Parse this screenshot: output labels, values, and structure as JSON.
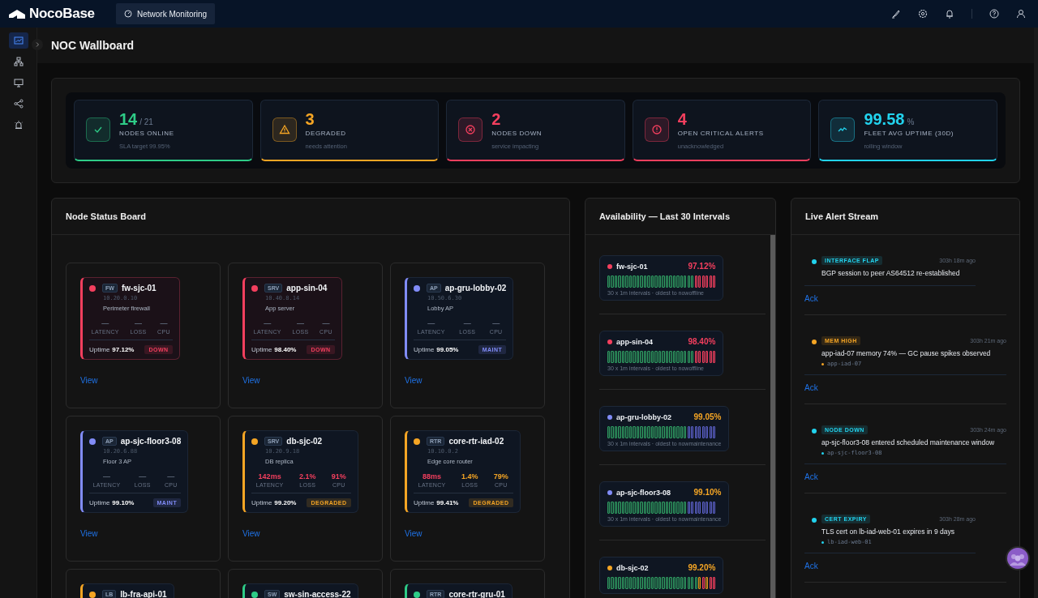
{
  "app": {
    "logo": "NocoBase",
    "tab": "Network Monitoring"
  },
  "sidebar": {
    "items": [
      {
        "selected": true
      },
      {
        "selected": false
      },
      {
        "selected": false
      },
      {
        "selected": false
      },
      {
        "selected": false
      }
    ]
  },
  "page_title": "NOC Wallboard",
  "kpis": [
    {
      "kind": "ok",
      "value": "14",
      "total": "/ 21",
      "label": "NODES ONLINE",
      "note": "SLA target 99.95%",
      "color": "#2ecc87"
    },
    {
      "kind": "warning",
      "value": "3",
      "label": "DEGRADED",
      "note": "needs attention",
      "color": "#f5a524"
    },
    {
      "kind": "down",
      "value": "2",
      "label": "NODES DOWN",
      "note": "service impacting",
      "color": "#f43f5e"
    },
    {
      "kind": "alert",
      "value": "4",
      "label": "OPEN CRITICAL ALERTS",
      "note": "unacknowledged",
      "color": "#f43f5e"
    },
    {
      "kind": "uptime",
      "value": "99.58",
      "unit": "%",
      "label": "FLEET AVG UPTIME (30D)",
      "note": "rolling window",
      "color": "#22d3ee"
    }
  ],
  "node_board": {
    "title": "Node Status Board",
    "nodes": [
      {
        "color": "#f43f5e",
        "critical": true,
        "type": "FW",
        "name": "fw-sjc-01",
        "ip": "10.20.0.10",
        "description": "Perimeter firewall",
        "metrics": [
          {
            "value": "—",
            "label": "LATENCY",
            "color": "#5b6677"
          },
          {
            "value": "—",
            "label": "LOSS",
            "color": "#5b6677"
          },
          {
            "value": "—",
            "label": "CPU",
            "color": "#5b6677"
          }
        ],
        "uptime_label": "Uptime",
        "uptime": "97.12%",
        "badge": "DOWN",
        "action": "View"
      },
      {
        "color": "#f43f5e",
        "critical": true,
        "type": "SRV",
        "name": "app-sin-04",
        "ip": "10.40.8.14",
        "description": "App server",
        "metrics": [
          {
            "value": "—",
            "label": "LATENCY",
            "color": "#5b6677"
          },
          {
            "value": "—",
            "label": "LOSS",
            "color": "#5b6677"
          },
          {
            "value": "—",
            "label": "CPU",
            "color": "#5b6677"
          }
        ],
        "uptime_label": "Uptime",
        "uptime": "98.40%",
        "badge": "DOWN",
        "action": "View"
      },
      {
        "color": "#818cf8",
        "critical": false,
        "type": "AP",
        "name": "ap-gru-lobby-02",
        "ip": "10.50.6.30",
        "description": "Lobby AP",
        "metrics": [
          {
            "value": "—",
            "label": "LATENCY",
            "color": "#5b6677"
          },
          {
            "value": "—",
            "label": "LOSS",
            "color": "#5b6677"
          },
          {
            "value": "—",
            "label": "CPU",
            "color": "#5b6677"
          }
        ],
        "uptime_label": "Uptime",
        "uptime": "99.05%",
        "badge": "MAINT",
        "action": "View"
      },
      {
        "color": "#818cf8",
        "critical": false,
        "type": "AP",
        "name": "ap-sjc-floor3-08",
        "ip": "10.20.6.88",
        "description": "Floor 3 AP",
        "metrics": [
          {
            "value": "—",
            "label": "LATENCY",
            "color": "#5b6677"
          },
          {
            "value": "—",
            "label": "LOSS",
            "color": "#5b6677"
          },
          {
            "value": "—",
            "label": "CPU",
            "color": "#5b6677"
          }
        ],
        "uptime_label": "Uptime",
        "uptime": "99.10%",
        "badge": "MAINT",
        "action": "View"
      },
      {
        "color": "#f5a524",
        "critical": false,
        "type": "SRV",
        "name": "db-sjc-02",
        "ip": "10.20.9.18",
        "description": "DB replica",
        "metrics": [
          {
            "value": "142ms",
            "label": "LATENCY",
            "color": "#f43f5e"
          },
          {
            "value": "2.1%",
            "label": "LOSS",
            "color": "#f43f5e"
          },
          {
            "value": "91%",
            "label": "CPU",
            "color": "#f43f5e"
          }
        ],
        "uptime_label": "Uptime",
        "uptime": "99.20%",
        "badge": "DEGRADED",
        "action": "View"
      },
      {
        "color": "#f5a524",
        "critical": false,
        "type": "RTR",
        "name": "core-rtr-iad-02",
        "ip": "10.10.0.2",
        "description": "Edge core router",
        "metrics": [
          {
            "value": "88ms",
            "label": "LATENCY",
            "color": "#f43f5e"
          },
          {
            "value": "1.4%",
            "label": "LOSS",
            "color": "#f5a524"
          },
          {
            "value": "79%",
            "label": "CPU",
            "color": "#f5a524"
          }
        ],
        "uptime_label": "Uptime",
        "uptime": "99.41%",
        "badge": "DEGRADED",
        "action": "View"
      },
      {
        "color": "#f5a524",
        "critical": false,
        "type": "LB",
        "name": "lb-fra-api-01"
      },
      {
        "color": "#2ecc87",
        "critical": false,
        "type": "SW",
        "name": "sw-sin-access-22"
      },
      {
        "color": "#2ecc87",
        "critical": false,
        "type": "RTR",
        "name": "core-rtr-gru-01"
      }
    ]
  },
  "availability": {
    "title": "Availability — Last 30 Intervals",
    "items": [
      {
        "color": "#f43f5e",
        "critical": true,
        "name": "fw-sjc-01",
        "uptime": "97.12%",
        "legend": "30 x 1m intervals · oldest to nowoffline",
        "bars": [
          {
            "color": "#2f9e62"
          },
          {
            "color": "#2f9e62"
          },
          {
            "color": "#2f9e62"
          },
          {
            "color": "#2f9e62"
          },
          {
            "color": "#2f9e62"
          },
          {
            "color": "#2f9e62"
          },
          {
            "color": "#2f9e62"
          },
          {
            "color": "#2f9e62"
          },
          {
            "color": "#2f9e62"
          },
          {
            "color": "#2f9e62"
          },
          {
            "color": "#2f9e62"
          },
          {
            "color": "#2f9e62"
          },
          {
            "color": "#2f9e62"
          },
          {
            "color": "#2f9e62"
          },
          {
            "color": "#2f9e62"
          },
          {
            "color": "#2f9e62"
          },
          {
            "color": "#2f9e62"
          },
          {
            "color": "#2f9e62"
          },
          {
            "color": "#2f9e62"
          },
          {
            "color": "#2f9e62"
          },
          {
            "color": "#2f9e62"
          },
          {
            "color": "#2f9e62"
          },
          {
            "color": "#2f9e62"
          },
          {
            "color": "#2f9e62"
          },
          {
            "color": "#f43f5e"
          },
          {
            "color": "#f43f5e"
          },
          {
            "color": "#f43f5e"
          },
          {
            "color": "#f43f5e"
          },
          {
            "color": "#f43f5e"
          },
          {
            "color": "#f43f5e"
          }
        ]
      },
      {
        "color": "#f43f5e",
        "critical": true,
        "name": "app-sin-04",
        "uptime": "98.40%",
        "legend": "30 x 1m intervals · oldest to nowoffline",
        "bars": [
          {
            "color": "#2f9e62"
          },
          {
            "color": "#2f9e62"
          },
          {
            "color": "#2f9e62"
          },
          {
            "color": "#2f9e62"
          },
          {
            "color": "#2f9e62"
          },
          {
            "color": "#2f9e62"
          },
          {
            "color": "#2f9e62"
          },
          {
            "color": "#2f9e62"
          },
          {
            "color": "#2f9e62"
          },
          {
            "color": "#2f9e62"
          },
          {
            "color": "#2f9e62"
          },
          {
            "color": "#2f9e62"
          },
          {
            "color": "#2f9e62"
          },
          {
            "color": "#2f9e62"
          },
          {
            "color": "#2f9e62"
          },
          {
            "color": "#2f9e62"
          },
          {
            "color": "#2f9e62"
          },
          {
            "color": "#2f9e62"
          },
          {
            "color": "#2f9e62"
          },
          {
            "color": "#2f9e62"
          },
          {
            "color": "#2f9e62"
          },
          {
            "color": "#2f9e62"
          },
          {
            "color": "#2f9e62"
          },
          {
            "color": "#2f9e62"
          },
          {
            "color": "#f43f5e"
          },
          {
            "color": "#f43f5e"
          },
          {
            "color": "#f43f5e"
          },
          {
            "color": "#f43f5e"
          },
          {
            "color": "#f43f5e"
          },
          {
            "color": "#f43f5e"
          }
        ]
      },
      {
        "color": "#818cf8",
        "critical": false,
        "name": "ap-gru-lobby-02",
        "uptime": "99.05%",
        "legend": "30 x 1m intervals · oldest to nowmaintenance",
        "bars": [
          {
            "color": "#2f9e62"
          },
          {
            "color": "#2f9e62"
          },
          {
            "color": "#2f9e62"
          },
          {
            "color": "#2f9e62"
          },
          {
            "color": "#2f9e62"
          },
          {
            "color": "#2f9e62"
          },
          {
            "color": "#2f9e62"
          },
          {
            "color": "#2f9e62"
          },
          {
            "color": "#2f9e62"
          },
          {
            "color": "#2f9e62"
          },
          {
            "color": "#2f9e62"
          },
          {
            "color": "#2f9e62"
          },
          {
            "color": "#2f9e62"
          },
          {
            "color": "#2f9e62"
          },
          {
            "color": "#2f9e62"
          },
          {
            "color": "#2f9e62"
          },
          {
            "color": "#2f9e62"
          },
          {
            "color": "#2f9e62"
          },
          {
            "color": "#2f9e62"
          },
          {
            "color": "#2f9e62"
          },
          {
            "color": "#2f9e62"
          },
          {
            "color": "#2f9e62"
          },
          {
            "color": "#5b60c8"
          },
          {
            "color": "#5b60c8"
          },
          {
            "color": "#5b60c8"
          },
          {
            "color": "#5b60c8"
          },
          {
            "color": "#5b60c8"
          },
          {
            "color": "#5b60c8"
          },
          {
            "color": "#5b60c8"
          },
          {
            "color": "#5b60c8"
          }
        ]
      },
      {
        "color": "#818cf8",
        "critical": false,
        "name": "ap-sjc-floor3-08",
        "uptime": "99.10%",
        "legend": "30 x 1m intervals · oldest to nowmaintenance",
        "bars": [
          {
            "color": "#2f9e62"
          },
          {
            "color": "#2f9e62"
          },
          {
            "color": "#2f9e62"
          },
          {
            "color": "#2f9e62"
          },
          {
            "color": "#2f9e62"
          },
          {
            "color": "#2f9e62"
          },
          {
            "color": "#2f9e62"
          },
          {
            "color": "#2f9e62"
          },
          {
            "color": "#2f9e62"
          },
          {
            "color": "#2f9e62"
          },
          {
            "color": "#2f9e62"
          },
          {
            "color": "#2f9e62"
          },
          {
            "color": "#2f9e62"
          },
          {
            "color": "#2f9e62"
          },
          {
            "color": "#2f9e62"
          },
          {
            "color": "#2f9e62"
          },
          {
            "color": "#2f9e62"
          },
          {
            "color": "#2f9e62"
          },
          {
            "color": "#2f9e62"
          },
          {
            "color": "#2f9e62"
          },
          {
            "color": "#2f9e62"
          },
          {
            "color": "#2f9e62"
          },
          {
            "color": "#5b60c8"
          },
          {
            "color": "#5b60c8"
          },
          {
            "color": "#5b60c8"
          },
          {
            "color": "#5b60c8"
          },
          {
            "color": "#5b60c8"
          },
          {
            "color": "#5b60c8"
          },
          {
            "color": "#5b60c8"
          },
          {
            "color": "#5b60c8"
          }
        ]
      },
      {
        "color": "#f5a524",
        "critical": false,
        "name": "db-sjc-02",
        "uptime": "99.20%",
        "bars": [
          {
            "color": "#2f9e62"
          },
          {
            "color": "#2f9e62"
          },
          {
            "color": "#2f9e62"
          },
          {
            "color": "#2f9e62"
          },
          {
            "color": "#2f9e62"
          },
          {
            "color": "#2f9e62"
          },
          {
            "color": "#2f9e62"
          },
          {
            "color": "#2f9e62"
          },
          {
            "color": "#2f9e62"
          },
          {
            "color": "#2f9e62"
          },
          {
            "color": "#2f9e62"
          },
          {
            "color": "#2f9e62"
          },
          {
            "color": "#2f9e62"
          },
          {
            "color": "#2f9e62"
          },
          {
            "color": "#2f9e62"
          },
          {
            "color": "#2f9e62"
          },
          {
            "color": "#2f9e62"
          },
          {
            "color": "#2f9e62"
          },
          {
            "color": "#2f9e62"
          },
          {
            "color": "#2f9e62"
          },
          {
            "color": "#2f9e62"
          },
          {
            "color": "#2f9e62"
          },
          {
            "color": "#2f9e62"
          },
          {
            "color": "#2f9e62"
          },
          {
            "color": "#2f9e62"
          },
          {
            "color": "#e69a1c"
          },
          {
            "color": "#f43f5e"
          },
          {
            "color": "#e69a1c"
          },
          {
            "color": "#f43f5e"
          },
          {
            "color": "#f43f5e"
          }
        ]
      }
    ]
  },
  "alerts": {
    "title": "Live Alert Stream",
    "items": [
      {
        "color": "#22d3ee",
        "tag": "INTERFACE FLAP",
        "time": "303h 18m ago",
        "message": "BGP session to peer AS64512 re-established",
        "action": "Ack"
      },
      {
        "color": "#f5a524",
        "tag": "MEM HIGH",
        "time": "303h 21m ago",
        "message": "app-iad-07 memory 74% — GC pause spikes observed",
        "node": "app-iad-07",
        "action": "Ack"
      },
      {
        "color": "#22d3ee",
        "tag": "NODE DOWN",
        "time": "303h 24m ago",
        "message": "ap-sjc-floor3-08 entered scheduled maintenance window",
        "node": "ap-sjc-floor3-08",
        "action": "Ack"
      },
      {
        "color": "#22d3ee",
        "tag": "CERT EXPIRY",
        "time": "303h 28m ago",
        "message": "TLS cert on lb-iad-web-01 expires in 9 days",
        "node": "lb-iad-web-01",
        "action": "Ack"
      }
    ]
  }
}
